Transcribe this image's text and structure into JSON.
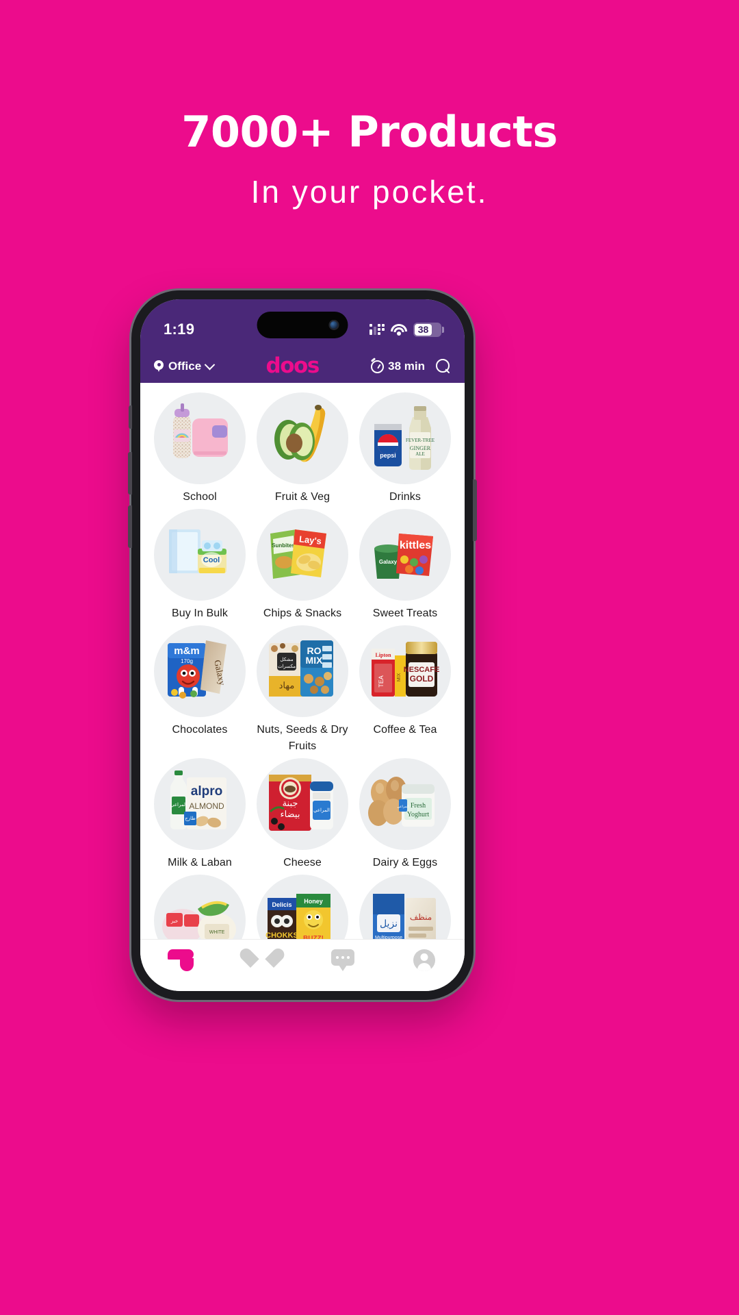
{
  "theme": {
    "background": "#ec0c8c",
    "brand_pink": "#ec0c8c",
    "app_purple": "#4a2878",
    "thumb_gray": "#eceef0"
  },
  "hero": {
    "title": "7000+ Products",
    "subtitle": "In your pocket."
  },
  "phone": {
    "status_bar": {
      "time": "1:19",
      "cellular_icon": "cellular-signal-icon",
      "wifi_icon": "wifi-icon",
      "battery_icon": "battery-icon",
      "battery_level": "38"
    },
    "app_header": {
      "location_icon": "map-pin-icon",
      "location_label": "Office",
      "location_chevron_icon": "chevron-down-icon",
      "brand": "doos",
      "eta_icon": "timer-icon",
      "eta_label": "38 min",
      "search_icon": "search-icon"
    },
    "categories": [
      {
        "label": "School",
        "art": "school"
      },
      {
        "label": "Fruit & Veg",
        "art": "fruitveg"
      },
      {
        "label": "Drinks",
        "art": "drinks"
      },
      {
        "label": "Buy In Bulk",
        "art": "bulk"
      },
      {
        "label": "Chips & Snacks",
        "art": "chips"
      },
      {
        "label": "Sweet Treats",
        "art": "sweets"
      },
      {
        "label": "Chocolates",
        "art": "chocolates"
      },
      {
        "label": "Nuts, Seeds & Dry Fruits",
        "art": "nuts"
      },
      {
        "label": "Coffee & Tea",
        "art": "coffee"
      },
      {
        "label": "Milk & Laban",
        "art": "milk"
      },
      {
        "label": "Cheese",
        "art": "cheese"
      },
      {
        "label": "Dairy & Eggs",
        "art": "eggs"
      },
      {
        "label": "",
        "art": "bread"
      },
      {
        "label": "",
        "art": "cereal"
      },
      {
        "label": "",
        "art": "juice"
      }
    ],
    "tabbar": [
      {
        "name": "home",
        "icon": "doos-leaf-icon",
        "active": true
      },
      {
        "name": "favorites",
        "icon": "heart-icon",
        "active": false
      },
      {
        "name": "chat",
        "icon": "chat-bubble-icon",
        "active": false
      },
      {
        "name": "account",
        "icon": "user-avatar-icon",
        "active": false
      }
    ]
  }
}
